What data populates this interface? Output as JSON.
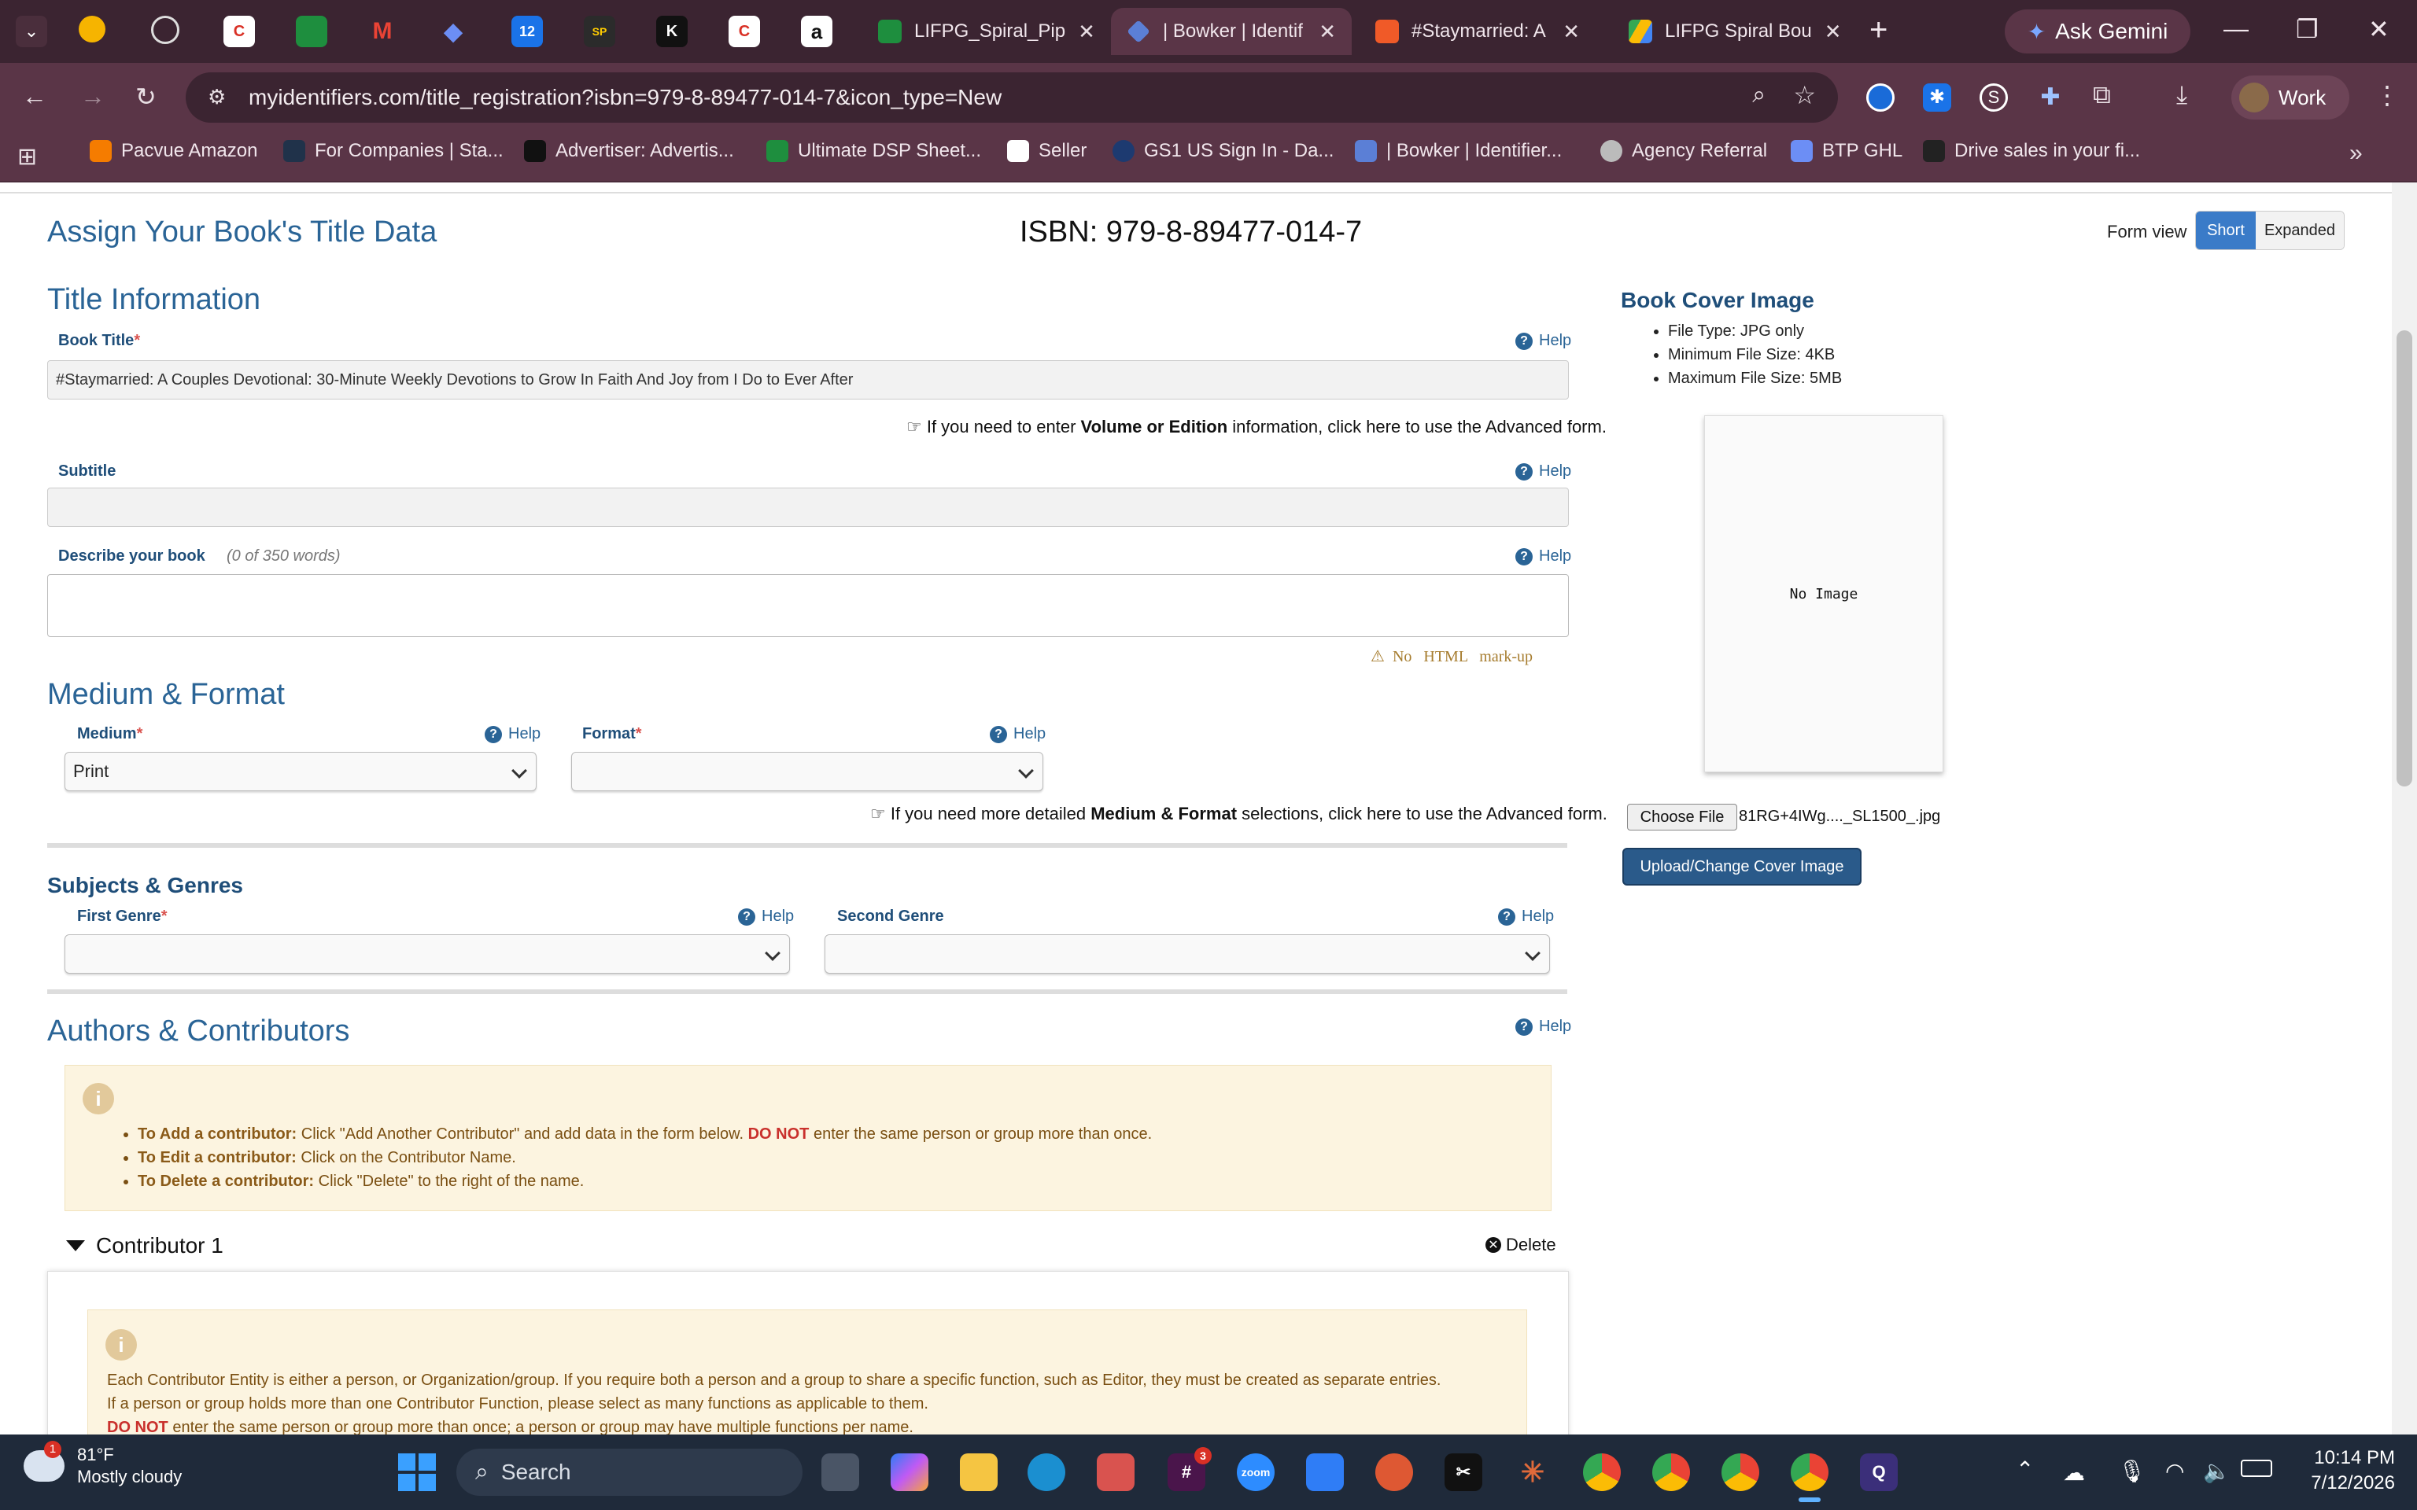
{
  "browser": {
    "tabs": [
      {
        "label": "LIFPG_Spiral_Pip",
        "color": "#1e8e3e"
      },
      {
        "label": "| Bowker | Identif",
        "color": "#5b7fd6"
      },
      {
        "label": "#Staymarried: A",
        "color": "#f05a28"
      },
      {
        "label": "LIFPG Spiral Bou",
        "color": "#2d7be5"
      }
    ],
    "pinned_tabs": [
      "K",
      "SP",
      "12"
    ],
    "ask_gemini": "Ask Gemini",
    "url": "myidentifiers.com/title_registration?isbn=979-8-89477-014-7&icon_type=New",
    "profile": "Work",
    "bookmarks": [
      "Pacvue Amazon",
      "For Companies | Sta...",
      "Advertiser: Advertis...",
      "Ultimate DSP Sheet...",
      "Seller",
      "GS1 US Sign In - Da...",
      "| Bowker | Identifier...",
      "Agency Referral",
      "BTP GHL",
      "Drive sales in your fi..."
    ]
  },
  "page": {
    "title": "Assign Your Book's Title Data",
    "isbn": "ISBN: 979-8-89477-014-7",
    "form_view_label": "Form view",
    "form_view_short": "Short",
    "form_view_expanded": "Expanded",
    "help": "Help",
    "title_info": {
      "heading": "Title Information",
      "book_title_label": "Book Title",
      "book_title_value": "#Staymarried: A Couples Devotional: 30-Minute Weekly Devotions to Grow In Faith And Joy from I Do to Ever After",
      "advanced_hint_pre": "If you need to enter ",
      "advanced_hint_bold": "Volume or Edition",
      "advanced_hint_post": " information, click here to use the Advanced form.",
      "subtitle_label": "Subtitle",
      "subtitle_value": "",
      "describe_label": "Describe your book",
      "describe_count": "(0 of 350 words)",
      "no_html": "No   HTML   mark-up"
    },
    "medium_format": {
      "heading": "Medium & Format",
      "medium_label": "Medium",
      "medium_value": "Print",
      "format_label": "Format",
      "format_value": "",
      "hint_pre": "If you need more detailed ",
      "hint_bold": "Medium & Format",
      "hint_post": " selections, click here to use the Advanced form."
    },
    "subjects": {
      "heading": "Subjects & Genres",
      "first_label": "First Genre",
      "second_label": "Second Genre"
    },
    "authors": {
      "heading": "Authors & Contributors",
      "notes": [
        {
          "bold": "To Add a contributor:",
          "text": " Click \"Add Another Contributor\" and add data in the form below. ",
          "red": "DO NOT",
          "tail": " enter the same person or group more than once."
        },
        {
          "bold": "To Edit a contributor:",
          "text": " Click on the Contributor Name."
        },
        {
          "bold": "To Delete a contributor:",
          "text": " Click \"Delete\" to the right of the name."
        }
      ],
      "contributor_title": "Contributor 1",
      "delete": "Delete",
      "entity_line1": "Each Contributor Entity is either a person, or Organization/group. If you require both a person and a group to share a specific function, such as Editor, they must be created as separate entries.",
      "entity_line2": "If a person or group holds more than one Contributor Function, please select as many functions as applicable to them.",
      "entity_line3_red": "DO NOT",
      "entity_line3": " enter the same person or group more than once; a person or group may have multiple functions per name."
    },
    "cover": {
      "heading": "Book Cover Image",
      "rules": [
        "File Type: JPG only",
        "Minimum File Size: 4KB",
        "Maximum File Size: 5MB"
      ],
      "no_image": "No Image",
      "choose_file": "Choose File",
      "file_name": "81RG+4IWg...._SL1500_.jpg",
      "upload": "Upload/Change Cover Image"
    }
  },
  "taskbar": {
    "temp": "81°F",
    "weather": "Mostly cloudy",
    "weather_badge": "1",
    "search": "Search",
    "time": "10:14 PM",
    "date": "7/12/2026",
    "slack_badge": "3"
  },
  "colors": {
    "accent": "#2a6496",
    "chrome_dark": "#3b2431",
    "chrome": "#5a3547",
    "upload_btn": "#2a5a8a"
  }
}
